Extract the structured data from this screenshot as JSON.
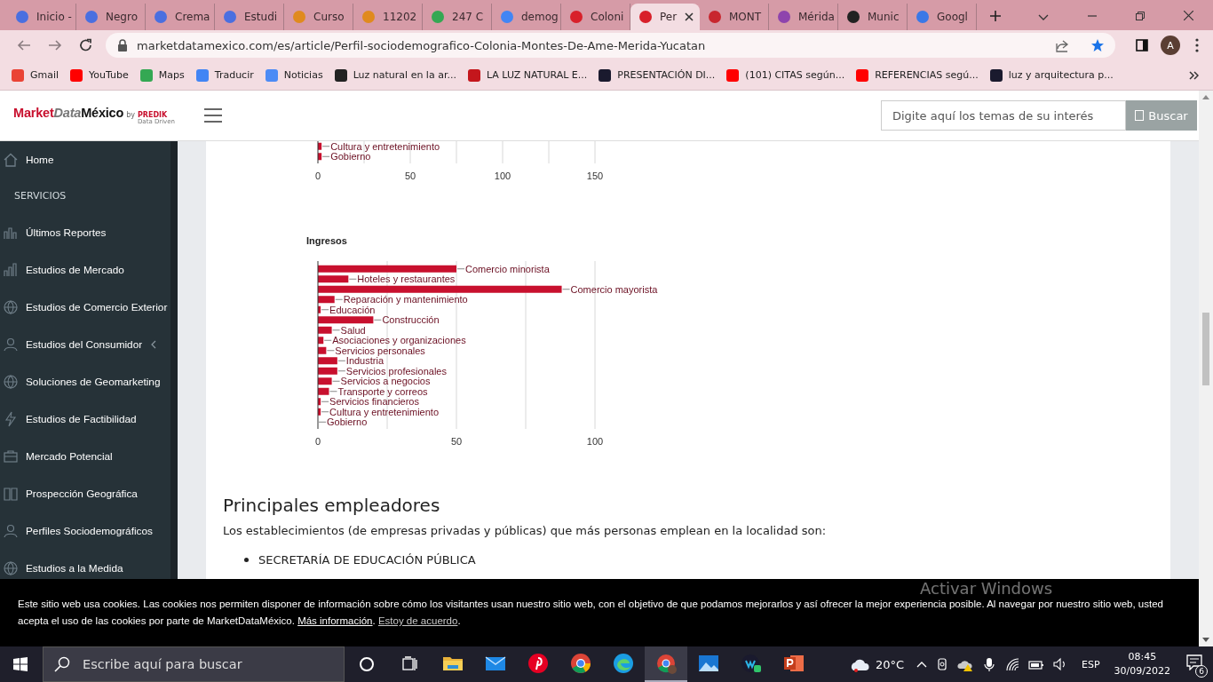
{
  "browser": {
    "tabs": [
      {
        "title": "Inicio -",
        "color": "#4a6fe0",
        "selected": false
      },
      {
        "title": "Negro",
        "color": "#4a6fe0",
        "selected": false
      },
      {
        "title": "Crema",
        "color": "#4a6fe0",
        "selected": false
      },
      {
        "title": "Estudi",
        "color": "#4a6fe0",
        "selected": false
      },
      {
        "title": "Curso",
        "color": "#e08a1e",
        "selected": false
      },
      {
        "title": "11202",
        "color": "#e08a1e",
        "selected": false
      },
      {
        "title": "247 C",
        "color": "#34a853",
        "selected": false
      },
      {
        "title": "demog",
        "color": "#4285f4",
        "selected": false
      },
      {
        "title": "Coloni",
        "color": "#d8202a",
        "selected": false
      },
      {
        "title": "Per",
        "color": "#d8202a",
        "selected": true
      },
      {
        "title": "MONT",
        "color": "#c8262e",
        "selected": false
      },
      {
        "title": "Mérida",
        "color": "#8e44ad",
        "selected": false
      },
      {
        "title": "Munic",
        "color": "#222222",
        "selected": false
      },
      {
        "title": "Googl",
        "color": "#3b78e7",
        "selected": false
      }
    ],
    "address": "marketdatamexico.com/es/article/Perfil-sociodemografico-Colonia-Montes-De-Ame-Merida-Yucatan",
    "avatar": "A",
    "bookmarks": [
      {
        "label": "Gmail",
        "color": "#ea4335"
      },
      {
        "label": "YouTube",
        "color": "#ff0000"
      },
      {
        "label": "Maps",
        "color": "#34a853"
      },
      {
        "label": "Traducir",
        "color": "#4285f4"
      },
      {
        "label": "Noticias",
        "color": "#4c8bf5"
      },
      {
        "label": "Luz natural en la ar...",
        "color": "#222222"
      },
      {
        "label": "LA LUZ NATURAL E...",
        "color": "#c4161c"
      },
      {
        "label": "PRESENTACIÓN DI...",
        "color": "#1a1a2e"
      },
      {
        "label": "(101) CITAS según...",
        "color": "#ff0000"
      },
      {
        "label": "REFERENCIAS segú...",
        "color": "#ff0000"
      },
      {
        "label": "luz y arquitectura p...",
        "color": "#1a1a2e"
      }
    ]
  },
  "site": {
    "logo": {
      "wordmark": [
        "Market",
        "Data",
        "México"
      ],
      "by": "by",
      "brand": "PREDIK",
      "tagline": "Data Driven"
    },
    "search": {
      "placeholder": "Digite aquí los temas de su interés",
      "button": "Buscar"
    },
    "sidebar": {
      "items": [
        {
          "label": "Home",
          "kind": "link"
        },
        {
          "label": "SERVICIOS",
          "kind": "heading"
        },
        {
          "label": "Últimos Reportes",
          "kind": "link"
        },
        {
          "label": "Estudios de Mercado",
          "kind": "link"
        },
        {
          "label": "Estudios de Comercio Exterior",
          "kind": "link"
        },
        {
          "label": "Estudios del Consumidor",
          "kind": "submenu"
        },
        {
          "label": "Soluciones de Geomarketing",
          "kind": "link"
        },
        {
          "label": "Estudios de Factibilidad",
          "kind": "link"
        },
        {
          "label": "Mercado Potencial",
          "kind": "link"
        },
        {
          "label": "Prospección Geográfica",
          "kind": "link"
        },
        {
          "label": "Perfiles Sociodemográficos",
          "kind": "link"
        },
        {
          "label": "Estudios a la Medida",
          "kind": "link"
        }
      ]
    },
    "content": {
      "charts": [
        {
          "chart_data": {
            "type": "bar",
            "orientation": "horizontal",
            "categories": [
              "Cultura y entretenimiento",
              "Gobierno"
            ],
            "series": [
              {
                "color": "#c8102e",
                "values": [
                  2,
                  2
                ]
              }
            ],
            "xlim": [
              0,
              150
            ],
            "xticks": [
              0,
              50,
              100,
              150
            ]
          }
        },
        {
          "chart_data": {
            "type": "bar",
            "orientation": "horizontal",
            "title": "Ingresos",
            "categories": [
              "Comercio minorista",
              "Hoteles y restaurantes",
              "Comercio mayorista",
              "Reparación y mantenimiento",
              "Educación",
              "Construcción",
              "Salud",
              "Asociaciones y organizaciones",
              "Servicios personales",
              "Industria",
              "Servicios profesionales",
              "Servicios a negocios",
              "Transporte y correos",
              "Servicios financieros",
              "Cultura y entretenimiento",
              "Gobierno"
            ],
            "series": [
              {
                "color": "#c8102e",
                "values": [
                  50,
                  11,
                  88,
                  6,
                  1,
                  20,
                  5,
                  2,
                  3,
                  7,
                  7,
                  5,
                  4,
                  1,
                  1,
                  0
                ]
              }
            ],
            "xlim": [
              0,
              100
            ],
            "xticks": [
              0,
              50,
              100
            ]
          }
        }
      ],
      "heading": "Principales empleadores",
      "intro": "Los establecimientos (de empresas privadas y públicas) que más personas emplean en la localidad son:",
      "employers": [
        "SECRETARÍA DE EDUCACIÓN PÚBLICA"
      ]
    },
    "cookie_notice": {
      "text": "Este sitio web usa cookies. Las cookies nos permiten disponer de información sobre cómo los visitantes usan nuestro sitio web, con el objetivo de que podamos mejorarlos y así ofrecer la mejor experiencia posible. Al navegar por nuestro sitio web, usted acepta el uso de las cookies por parte de MarketDataMéxico.",
      "more_link": "Más información",
      "after_more": ".",
      "accept_link": "Estoy de acuerdo",
      "after_accept": "."
    }
  },
  "activation": {
    "title": "Activar Windows"
  },
  "taskbar": {
    "search_placeholder": "Escribe aquí para buscar",
    "apps": [
      {
        "kind": "explorer",
        "selected": false
      },
      {
        "kind": "mail",
        "selected": false
      },
      {
        "kind": "pinterest",
        "selected": false
      },
      {
        "kind": "chrome",
        "selected": false
      },
      {
        "kind": "edge",
        "selected": false
      },
      {
        "kind": "chrome-profile",
        "selected": true
      },
      {
        "kind": "photos",
        "selected": false
      },
      {
        "kind": "webex",
        "selected": false
      },
      {
        "kind": "powerpoint",
        "selected": false
      }
    ],
    "weather": "20°C",
    "language": "ESP",
    "time": "08:45",
    "date": "30/09/2022",
    "notifications": "6"
  }
}
